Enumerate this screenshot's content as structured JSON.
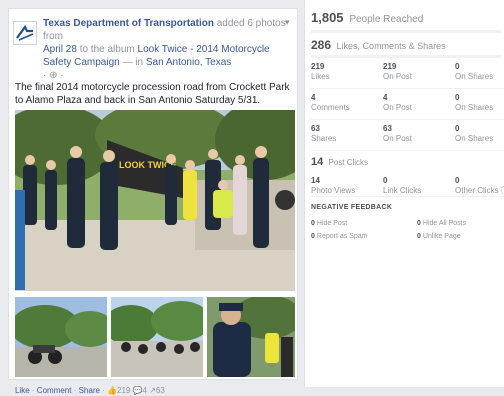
{
  "post": {
    "page_name": "Texas Department of Transportation",
    "action_text": "added 6 photos from",
    "date": "April 28",
    "album_prefix": "to the album",
    "album_name": "Look Twice - 2014 Motorcycle Safety Campaign",
    "location_prefix": "— in",
    "location": "San Antonio, Texas",
    "meta_icons": "· ⊕ ·",
    "body": "The final 2014 motorcycle procession road from Crockett Park to Alamo Plaza and back in San Antonio Saturday 5/31.",
    "banner_text": "LOOK TWICE",
    "footer": {
      "like": "Like",
      "comment": "Comment",
      "share": "Share",
      "stats": "👍219 💬4 ↗63"
    }
  },
  "insights": {
    "reach_value": "1,805",
    "reach_label": "People Reached",
    "engagement_value": "286",
    "engagement_label": "Likes, Comments & Shares",
    "rows": [
      [
        {
          "v": "219",
          "l": "Likes"
        },
        {
          "v": "219",
          "l": "On Post"
        },
        {
          "v": "0",
          "l": "On Shares"
        }
      ],
      [
        {
          "v": "4",
          "l": "Comments"
        },
        {
          "v": "4",
          "l": "On Post"
        },
        {
          "v": "0",
          "l": "On Shares"
        }
      ],
      [
        {
          "v": "63",
          "l": "Shares"
        },
        {
          "v": "63",
          "l": "On Post"
        },
        {
          "v": "0",
          "l": "On Shares"
        }
      ]
    ],
    "clicks_value": "14",
    "clicks_label": "Post Clicks",
    "click_row": [
      {
        "v": "14",
        "l": "Photo Views"
      },
      {
        "v": "0",
        "l": "Link Clicks"
      },
      {
        "v": "0",
        "l": "Other Clicks ⓘ"
      }
    ],
    "negative_title": "NEGATIVE FEEDBACK",
    "negative": [
      {
        "v": "0",
        "l": "Hide Post"
      },
      {
        "v": "0",
        "l": "Hide All Posts"
      },
      {
        "v": "0",
        "l": "Report as Spam"
      },
      {
        "v": "0",
        "l": "Unlike Page"
      }
    ]
  }
}
